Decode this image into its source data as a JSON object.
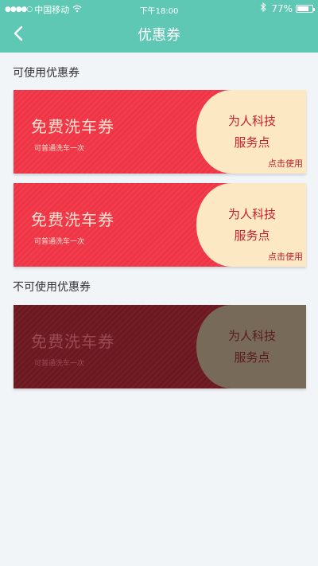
{
  "status_bar": {
    "signal_dots": "●●●●○",
    "carrier": "中国移动",
    "wifi_icon": "wifi-icon",
    "time": "下午18:00",
    "bluetooth_icon": "bluetooth-icon",
    "battery_percent": "77%",
    "battery_level": 0.77
  },
  "header": {
    "title": "优惠券",
    "back_icon": "chevron-left-icon",
    "background": "#5ec8b4"
  },
  "sections": {
    "usable_label": "可使用优惠券",
    "unusable_label": "不可使用优惠券"
  },
  "coupons": [
    {
      "title": "免费洗车券",
      "desc": "可普通洗车一次",
      "merchant": "为人科技\n服务点",
      "action": "点击使用",
      "status": "active"
    },
    {
      "title": "免费洗车券",
      "desc": "可普通洗车一次",
      "merchant": "为人科技\n服务点",
      "action": "点击使用",
      "status": "active"
    },
    {
      "title": "免费洗车券",
      "desc": "可普通洗车一次",
      "merchant": "为人科技\n服务点",
      "status": "inactive"
    }
  ],
  "colors": {
    "active_red": "#ef3445",
    "active_cream": "#fde8c4",
    "inactive_maroon": "#6b1821",
    "inactive_brown": "#786a58"
  }
}
